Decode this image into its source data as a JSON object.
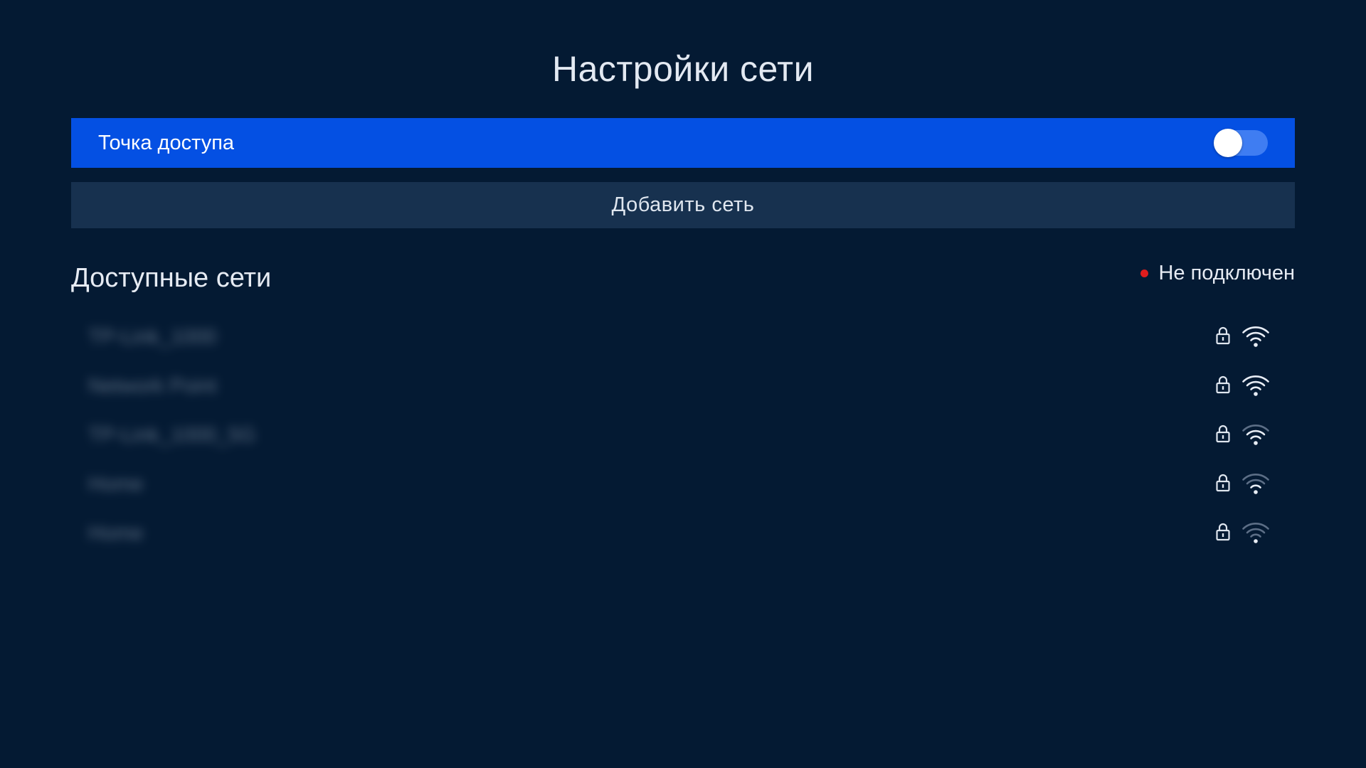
{
  "header": {
    "title": "Настройки сети"
  },
  "hotspot": {
    "label": "Точка доступа",
    "toggle_on": false
  },
  "add_network": {
    "label": "Добавить сеть"
  },
  "networks_section": {
    "title": "Доступные сети",
    "status_text": "Не подключен",
    "status_color": "#e11d1d"
  },
  "networks": [
    {
      "name": "TP-Link_1000",
      "secured": true,
      "signal_bars": 4
    },
    {
      "name": "Network Point",
      "secured": true,
      "signal_bars": 4
    },
    {
      "name": "TP-Link_1000_5G",
      "secured": true,
      "signal_bars": 3
    },
    {
      "name": "Home",
      "secured": true,
      "signal_bars": 2
    },
    {
      "name": "Home",
      "secured": true,
      "signal_bars": 1
    }
  ],
  "colors": {
    "background": "#041a33",
    "accent": "#0450e3",
    "button_bg": "#17314f"
  },
  "icons": {
    "lock": "lock-icon",
    "wifi": "wifi-icon"
  }
}
